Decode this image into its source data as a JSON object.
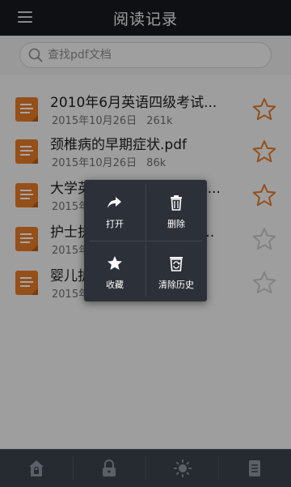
{
  "header": {
    "title": "阅读记录",
    "menu_icon": "hamburger-icon"
  },
  "search": {
    "placeholder": "查找pdf文档",
    "icon": "search-icon"
  },
  "files": [
    {
      "name": "2010年6月英语四级考试...",
      "date": "2015年10月26日",
      "size": "261k",
      "starred": false
    },
    {
      "name": "颈椎病的早期症状.pdf",
      "date": "2015年10月26日",
      "size": "86k",
      "starred": false
    },
    {
      "name": "大学英语精读词汇PDF_含...",
      "date": "2015年10月26日",
      "size": "",
      "starred": false
    },
    {
      "name": "护士执业资格考试模拟测...",
      "date": "2015年10月26日",
      "size": "",
      "starred": false
    },
    {
      "name": "婴儿护理常识大全.pdf",
      "date": "2015年10月26日",
      "size": "",
      "starred": false
    }
  ],
  "context_menu": {
    "open_label": "打开",
    "delete_label": "删除",
    "favorite_label": "收藏",
    "clear_history_label": "清除历史"
  },
  "bottom_tabs": [
    "home-lock-icon",
    "lock-icon",
    "brightness-icon",
    "document-icon"
  ],
  "colors": {
    "accent": "#e57a27",
    "header_bg": "#171a1f",
    "menu_bg": "#2c3038"
  }
}
